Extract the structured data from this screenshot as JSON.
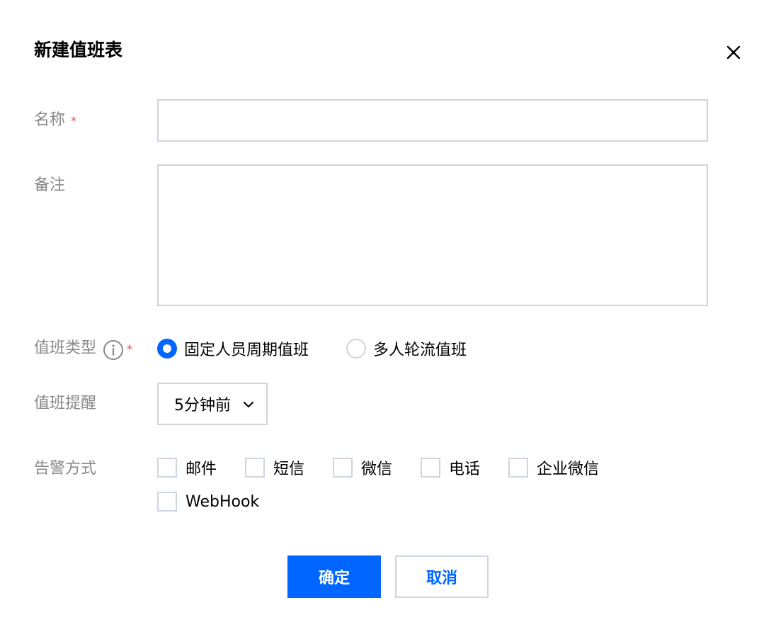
{
  "dialog": {
    "title": "新建值班表"
  },
  "form": {
    "name": {
      "label": "名称",
      "required": "*",
      "value": "",
      "placeholder": ""
    },
    "remark": {
      "label": "备注",
      "value": "",
      "placeholder": ""
    },
    "duty_type": {
      "label": "值班类型",
      "required": "*",
      "options": [
        {
          "label": "固定人员周期值班",
          "checked": true
        },
        {
          "label": "多人轮流值班",
          "checked": false
        }
      ]
    },
    "reminder": {
      "label": "值班提醒",
      "selected": "5分钟前"
    },
    "alert_methods": {
      "label": "告警方式",
      "options": [
        {
          "label": "邮件",
          "checked": false
        },
        {
          "label": "短信",
          "checked": false
        },
        {
          "label": "微信",
          "checked": false
        },
        {
          "label": "电话",
          "checked": false
        },
        {
          "label": "企业微信",
          "checked": false
        },
        {
          "label": "WebHook",
          "checked": false
        }
      ]
    }
  },
  "buttons": {
    "confirm": "确定",
    "cancel": "取消"
  },
  "colors": {
    "primary": "#0066ff",
    "required": "#e54545",
    "label": "#888888",
    "border": "#cfd5de"
  },
  "icons": {
    "close": "close-icon",
    "info": "info-circle-icon",
    "chevron": "chevron-down-icon"
  }
}
